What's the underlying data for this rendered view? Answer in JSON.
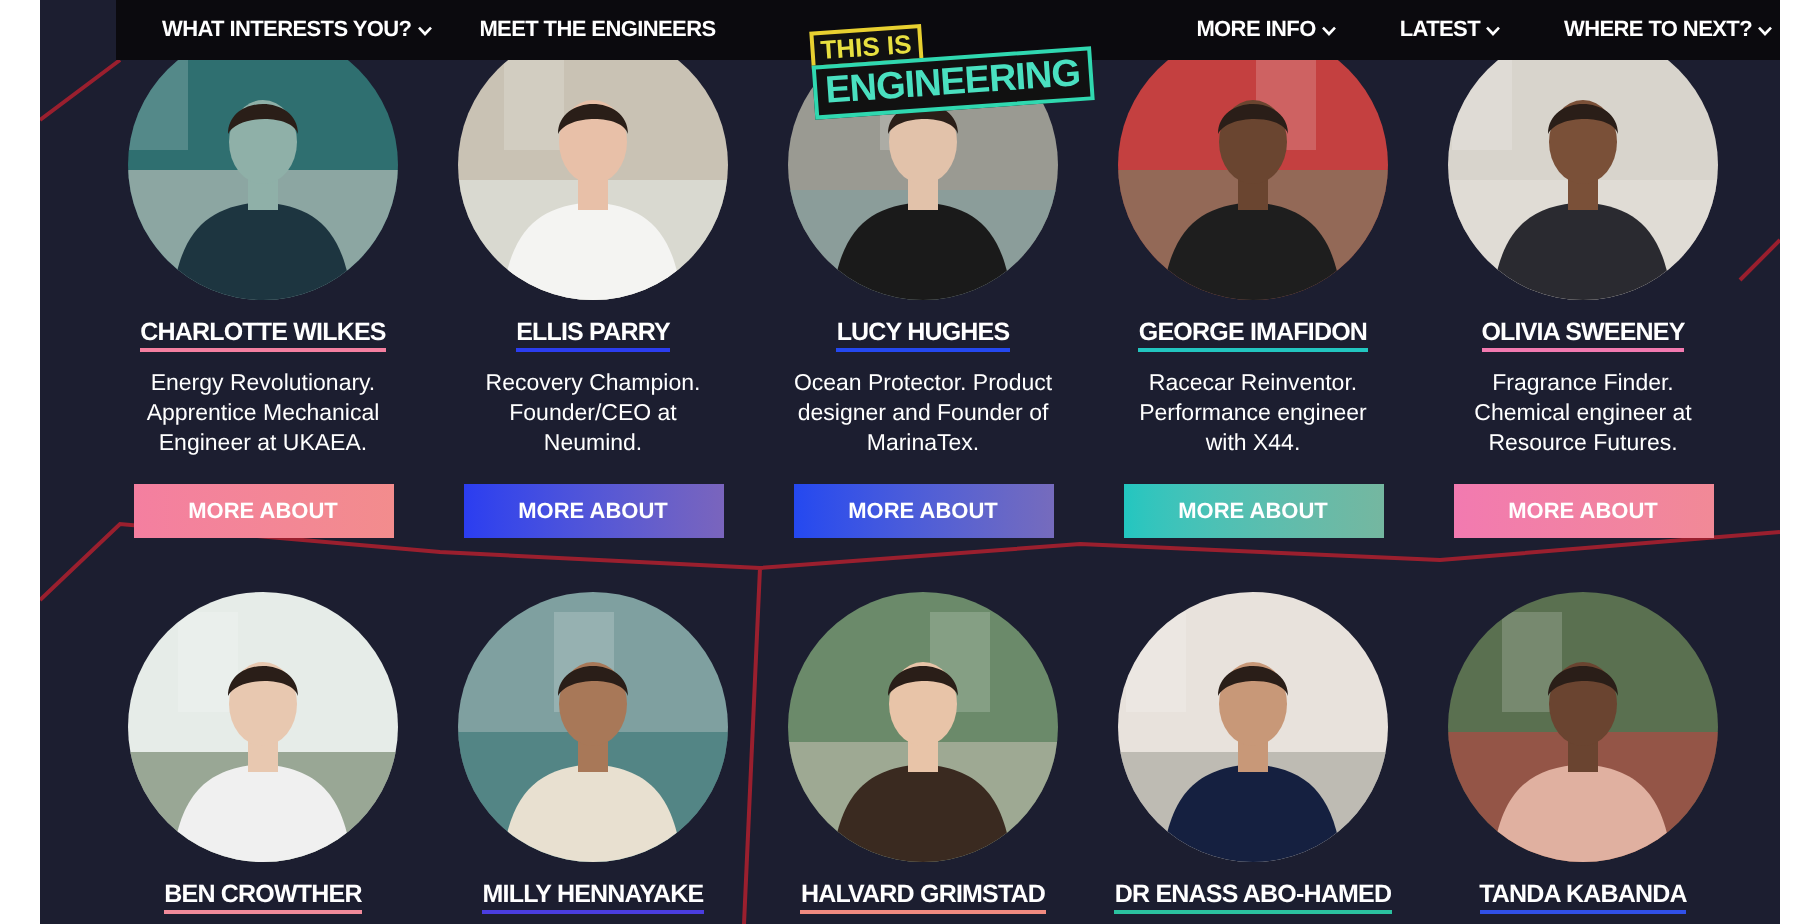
{
  "nav": {
    "items": [
      {
        "label": "WHAT INTERESTS YOU?",
        "has_menu": true
      },
      {
        "label": "MEET THE ENGINEERS",
        "has_menu": false
      },
      {
        "label": "MORE INFO",
        "has_menu": true
      },
      {
        "label": "LATEST",
        "has_menu": true
      },
      {
        "label": "WHERE TO NEXT?",
        "has_menu": true
      }
    ]
  },
  "logo": {
    "line1": "THIS IS",
    "line2": "ENGINEERING"
  },
  "engineers": [
    {
      "name": "CHARLOTTE WILKES",
      "description": "Energy Revolutionary. Apprentice Mechanical Engineer at UKAEA.",
      "button": "MORE ABOUT",
      "color": "#f47fa0"
    },
    {
      "name": "ELLIS PARRY",
      "description": "Recovery Champion. Founder/CEO at Neumind.",
      "button": "MORE ABOUT",
      "color": "#2b3df0"
    },
    {
      "name": "LUCY HUGHES",
      "description": "Ocean Protector. Product designer and Founder of MarinaTex.",
      "button": "MORE ABOUT",
      "color": "#2448f0"
    },
    {
      "name": "GEORGE IMAFIDON",
      "description": "Racecar Reinventor. Performance engineer with X44.",
      "button": "MORE ABOUT",
      "color": "#22c6c0"
    },
    {
      "name": "OLIVIA SWEENEY",
      "description": "Fragrance Finder. Chemical engineer at Resource Futures.",
      "button": "MORE ABOUT",
      "color": "#f27ab0"
    },
    {
      "name": "BEN CROWTHER",
      "color": "#f08a9a"
    },
    {
      "name": "MILLY HENNAYAKE",
      "color": "#4a3de0"
    },
    {
      "name": "HALVARD GRIMSTAD",
      "color": "#f08a80"
    },
    {
      "name": "DR ENASS ABO-HAMED",
      "color": "#2bc2a0"
    },
    {
      "name": "TANDA KABANDA",
      "color": "#3050e8"
    }
  ]
}
